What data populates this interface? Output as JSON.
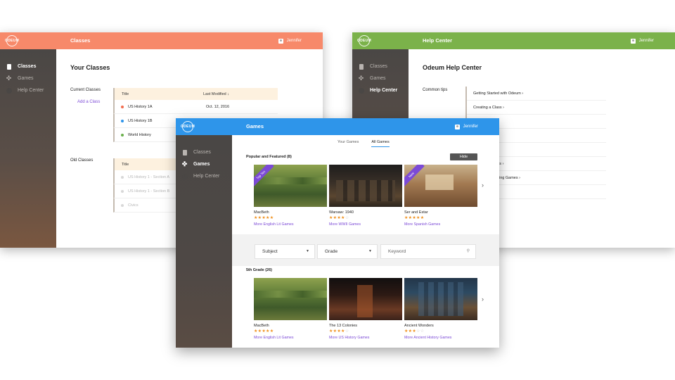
{
  "brand": "ODEUM",
  "user_name": "Jennifer",
  "nav": {
    "classes": "Classes",
    "games": "Games",
    "help": "Help Center"
  },
  "classes_window": {
    "header_title": "Classes",
    "page_title": "Your Classes",
    "current_label": "Current Classes",
    "add_class": "Add a Class",
    "columns": {
      "title": "Title",
      "modified": "Last Modified ↓"
    },
    "current_rows": [
      {
        "title": "US History 1A",
        "modified": "Oct. 12, 2016",
        "color": "#f26d4f"
      },
      {
        "title": "US History 1B",
        "modified": "",
        "color": "#2e95ea"
      },
      {
        "title": "World History",
        "modified": "",
        "color": "#6ab04c"
      }
    ],
    "old_label": "Old Classes",
    "old_rows": [
      {
        "title": "US History 1 - Section A"
      },
      {
        "title": "US History 1 - Section B"
      },
      {
        "title": "Civics"
      }
    ]
  },
  "help_window": {
    "header_title": "Help Center",
    "page_title": "Odeum Help Center",
    "tips_label": "Common tips",
    "items": [
      "Getting Started with Odeum ›",
      "Creating a Class ›",
      "ts to a Class ›",
      "›",
      "e to a Class ›",
      "Creating Games ›",
      "e Progress During Games ›",
      "et Data ›"
    ]
  },
  "games_window": {
    "header_title": "Games",
    "tabs": [
      "Your Games",
      "All Games"
    ],
    "active_tab": "All Games",
    "featured_label": "Popular and Featured (8)",
    "hide_button": "Hide",
    "featured": [
      {
        "title": "MacBeth",
        "rating": 5,
        "link": "More English Lit Games",
        "ribbon": "Top Ten",
        "scene": "forest"
      },
      {
        "title": "Warsaw: 1940",
        "rating": 4,
        "link": "More WWII Games",
        "ribbon": "",
        "scene": "city"
      },
      {
        "title": "Ser and Estar",
        "rating": 5,
        "link": "More Spanish Games",
        "ribbon": "New",
        "scene": "room"
      }
    ],
    "filters": {
      "subject": "Subject",
      "grade": "Grade",
      "keyword_placeholder": "Keyword"
    },
    "grade_label": "5th Grade  (26)",
    "grade_games": [
      {
        "title": "MacBeth",
        "rating": 5,
        "link": "More English Lit Games",
        "scene": "forest"
      },
      {
        "title": "The 13 Colonies",
        "rating": 4,
        "link": "More US History Games",
        "scene": "street"
      },
      {
        "title": "Ancient Wonders",
        "rating": 3,
        "link": "More Ancient History Games",
        "scene": "temple"
      }
    ],
    "next_arrow": "›",
    "colors": {
      "header": "#2e95ea",
      "link": "#7c4ad6",
      "star": "#f0901c"
    }
  }
}
